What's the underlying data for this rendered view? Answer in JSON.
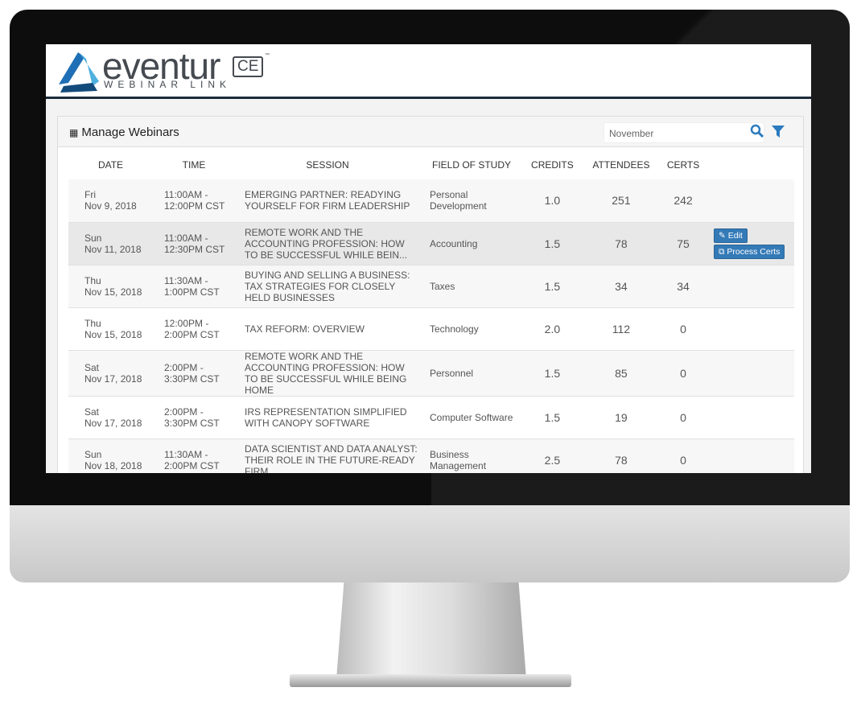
{
  "brand": {
    "name": "eventur",
    "badge": "CE",
    "tm": "™",
    "subtitle": "WEBINAR LINK",
    "colors": {
      "accent": "#2b7bbf",
      "dark": "#1d2b3a"
    }
  },
  "panel": {
    "title": "Manage Webinars",
    "icon": "grid-icon",
    "search_value": "November",
    "search_icon": "search-icon",
    "filter_icon": "filter-icon"
  },
  "columns": [
    "DATE",
    "TIME",
    "SESSION",
    "FIELD OF STUDY",
    "CREDITS",
    "ATTENDEES",
    "CERTS"
  ],
  "actions": {
    "edit": "Edit",
    "process": "Process Certs"
  },
  "rows": [
    {
      "day": "Fri",
      "date": "Nov 9, 2018",
      "time1": "11:00AM -",
      "time2": "12:00PM CST",
      "session": "Emerging Partner: Readying Yourself for Firm Leadership",
      "field": "Personal Development",
      "credits": "1.0",
      "attendees": "251",
      "certs": "242"
    },
    {
      "day": "Sun",
      "date": "Nov 11, 2018",
      "time1": "11:00AM -",
      "time2": "12:30PM CST",
      "session": "Remote Work and the Accounting Profession: How to Be Successful While Bein...",
      "field": "Accounting",
      "credits": "1.5",
      "attendees": "78",
      "certs": "75"
    },
    {
      "day": "Thu",
      "date": "Nov 15, 2018",
      "time1": "11:30AM -",
      "time2": "1:00PM CST",
      "session": "Buying and Selling a Business: Tax Strategies for Closely Held Businesses",
      "field": "Taxes",
      "credits": "1.5",
      "attendees": "34",
      "certs": "34"
    },
    {
      "day": "Thu",
      "date": "Nov 15, 2018",
      "time1": "12:00PM -",
      "time2": "2:00PM CST",
      "session": "Tax Reform: Overview",
      "field": "Technology",
      "credits": "2.0",
      "attendees": "112",
      "certs": "0"
    },
    {
      "day": "Sat",
      "date": "Nov 17, 2018",
      "time1": "2:00PM -",
      "time2": "3:30PM CST",
      "session": "Remote Work and the Accounting Profession: How to Be Successful While Being Home",
      "field": "Personnel",
      "credits": "1.5",
      "attendees": "85",
      "certs": "0"
    },
    {
      "day": "Sat",
      "date": "Nov 17, 2018",
      "time1": "2:00PM -",
      "time2": "3:30PM CST",
      "session": "IRS Representation Simplified with Canopy Software",
      "field": "Computer Software",
      "credits": "1.5",
      "attendees": "19",
      "certs": "0"
    },
    {
      "day": "Sun",
      "date": "Nov 18, 2018",
      "time1": "11:30AM -",
      "time2": "2:00PM CST",
      "session": "Data Scientist and Data Analyst: Their Role in the Future-Ready Firm",
      "field": "Business Management",
      "credits": "2.5",
      "attendees": "78",
      "certs": "0"
    }
  ]
}
